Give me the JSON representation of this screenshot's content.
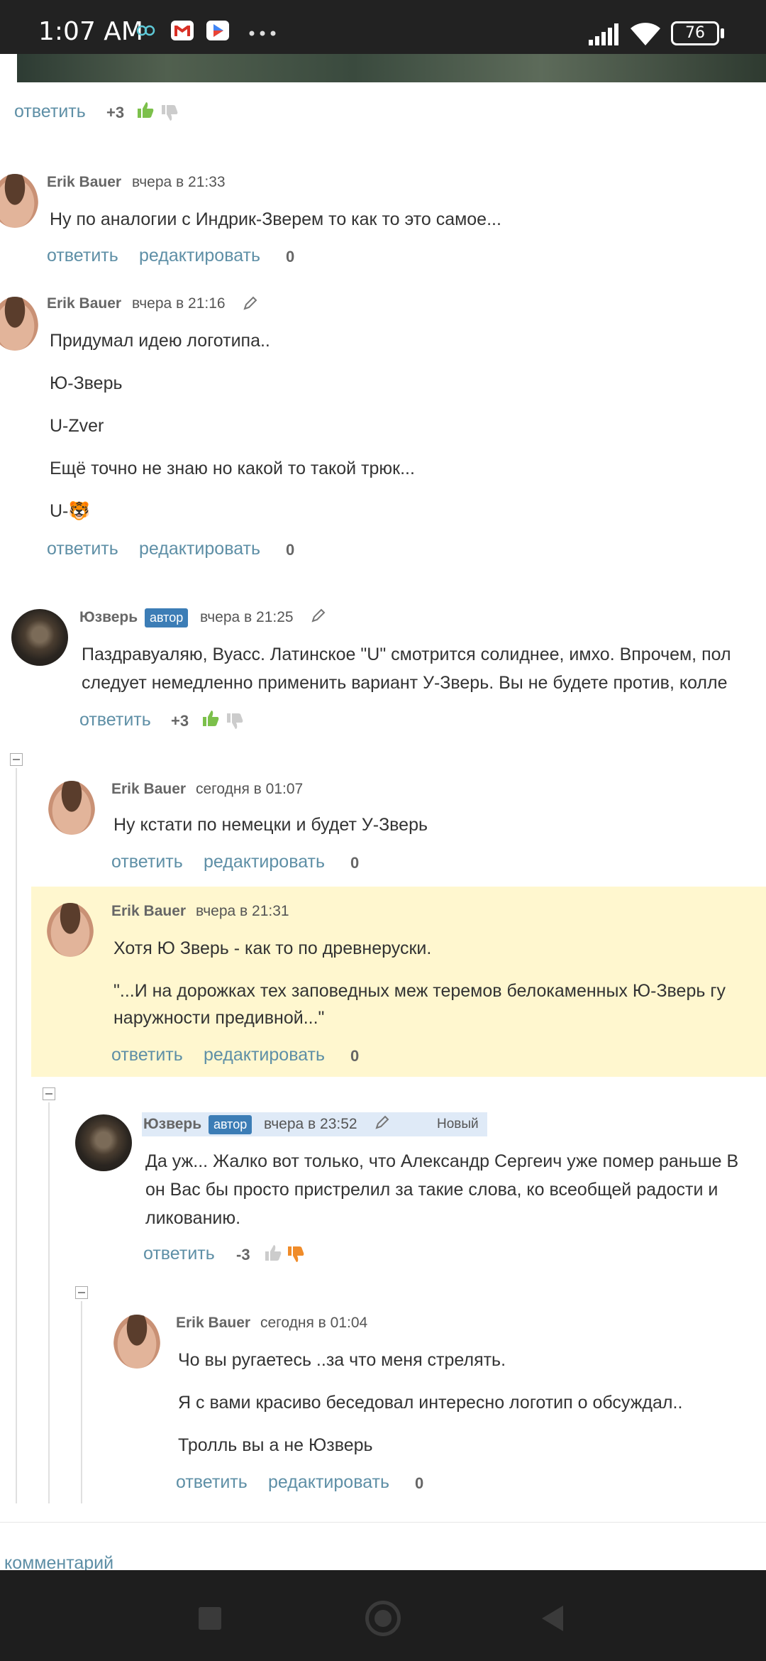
{
  "status": {
    "time": "1:07 AM",
    "battery": "76"
  },
  "top_actions": {
    "reply": "ответить",
    "score": "+3"
  },
  "comments": [
    {
      "author": "Erik Bauer",
      "date": "вчера в 21:33",
      "edited": false,
      "lines": [
        "Ну по аналогии с Индрик-Зверем то как то это самое..."
      ],
      "reply": "ответить",
      "edit": "редактировать",
      "score": "0"
    },
    {
      "author": "Erik Bauer",
      "date": "вчера в 21:16",
      "edited": true,
      "lines": [
        "Придумал идею логотипа..",
        "Ю-Зверь",
        "U-Zver",
        "Ещё точно не знаю но какой то такой трюк...",
        "U-🐯"
      ],
      "reply": "ответить",
      "edit": "редактировать",
      "score": "0"
    },
    {
      "author": "Юзверь",
      "badge": "автор",
      "date": "вчера в 21:25",
      "edited": true,
      "lines": [
        "Паздравуаляю, Вуасс. Латинское \"U\" смотрится солиднее, имхо. Впрочем, пол",
        "следует немедленно применить вариант У-Зверь. Вы не будете против, колле"
      ],
      "reply": "ответить",
      "score": "+3"
    },
    {
      "author": "Erik Bauer",
      "date": "сегодня в 01:07",
      "lines": [
        "Ну кстати по немецки и будет У-Зверь"
      ],
      "reply": "ответить",
      "edit": "редактировать",
      "score": "0"
    },
    {
      "author": "Erik Bauer",
      "date": "вчера в 21:31",
      "highlighted": true,
      "lines": [
        "Хотя Ю Зверь - как то по древнеруски.",
        "\"...И на дорожках тех заповедных меж теремов белокаменных Ю-Зверь гу",
        "наружности предивной...\""
      ],
      "reply": "ответить",
      "edit": "редактировать",
      "score": "0"
    },
    {
      "author": "Юзверь",
      "badge": "автор",
      "date": "вчера в 23:52",
      "edited": true,
      "new_label": "Новый",
      "lines": [
        "Да уж... Жалко вот только, что Александр Сергеич уже помер раньше В",
        "он Вас бы просто пристрелил за такие слова, ко всеобщей радости и",
        "ликованию."
      ],
      "reply": "ответить",
      "score": "-3"
    },
    {
      "author": "Erik Bauer",
      "date": "сегодня в 01:04",
      "lines": [
        "Чо  вы ругаетесь ..за что меня стрелять.",
        "Я с вами красиво беседовал интересно логотип о обсуждал..",
        "Тролль вы а не Юзверь"
      ],
      "reply": "ответить",
      "edit": "редактировать",
      "score": "0"
    }
  ],
  "footer": {
    "comment_link": "комментарий"
  },
  "colors": {
    "link": "#5e8fa6",
    "badge": "#3c7db6",
    "highlight": "#fff7cf",
    "like": "#7cc04b",
    "dislike": "#f08c2a"
  }
}
